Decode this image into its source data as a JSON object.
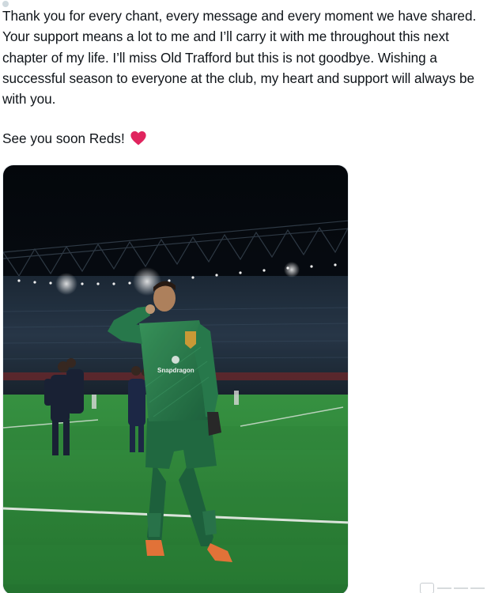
{
  "tweet": {
    "body": "Thank you for every chant, every message and every moment we have shared. Your support means a lot to me and I’ll carry it with me throughout this next chapter of my life. I’ll miss Old Trafford but this is not goodbye. Wishing a successful season to everyone at the club, my heart and support will always be with you.",
    "closing": "See you soon Reds!",
    "closing_emoji": "red-heart-icon"
  },
  "media": {
    "kind": "photo",
    "sponsor_text": "Snapdragon"
  },
  "colors": {
    "heart": "#e0245e",
    "text": "#0f1419",
    "kit": "#2f7d4f",
    "pitch": "#2f8a3c",
    "boots": "#f07a3c"
  }
}
